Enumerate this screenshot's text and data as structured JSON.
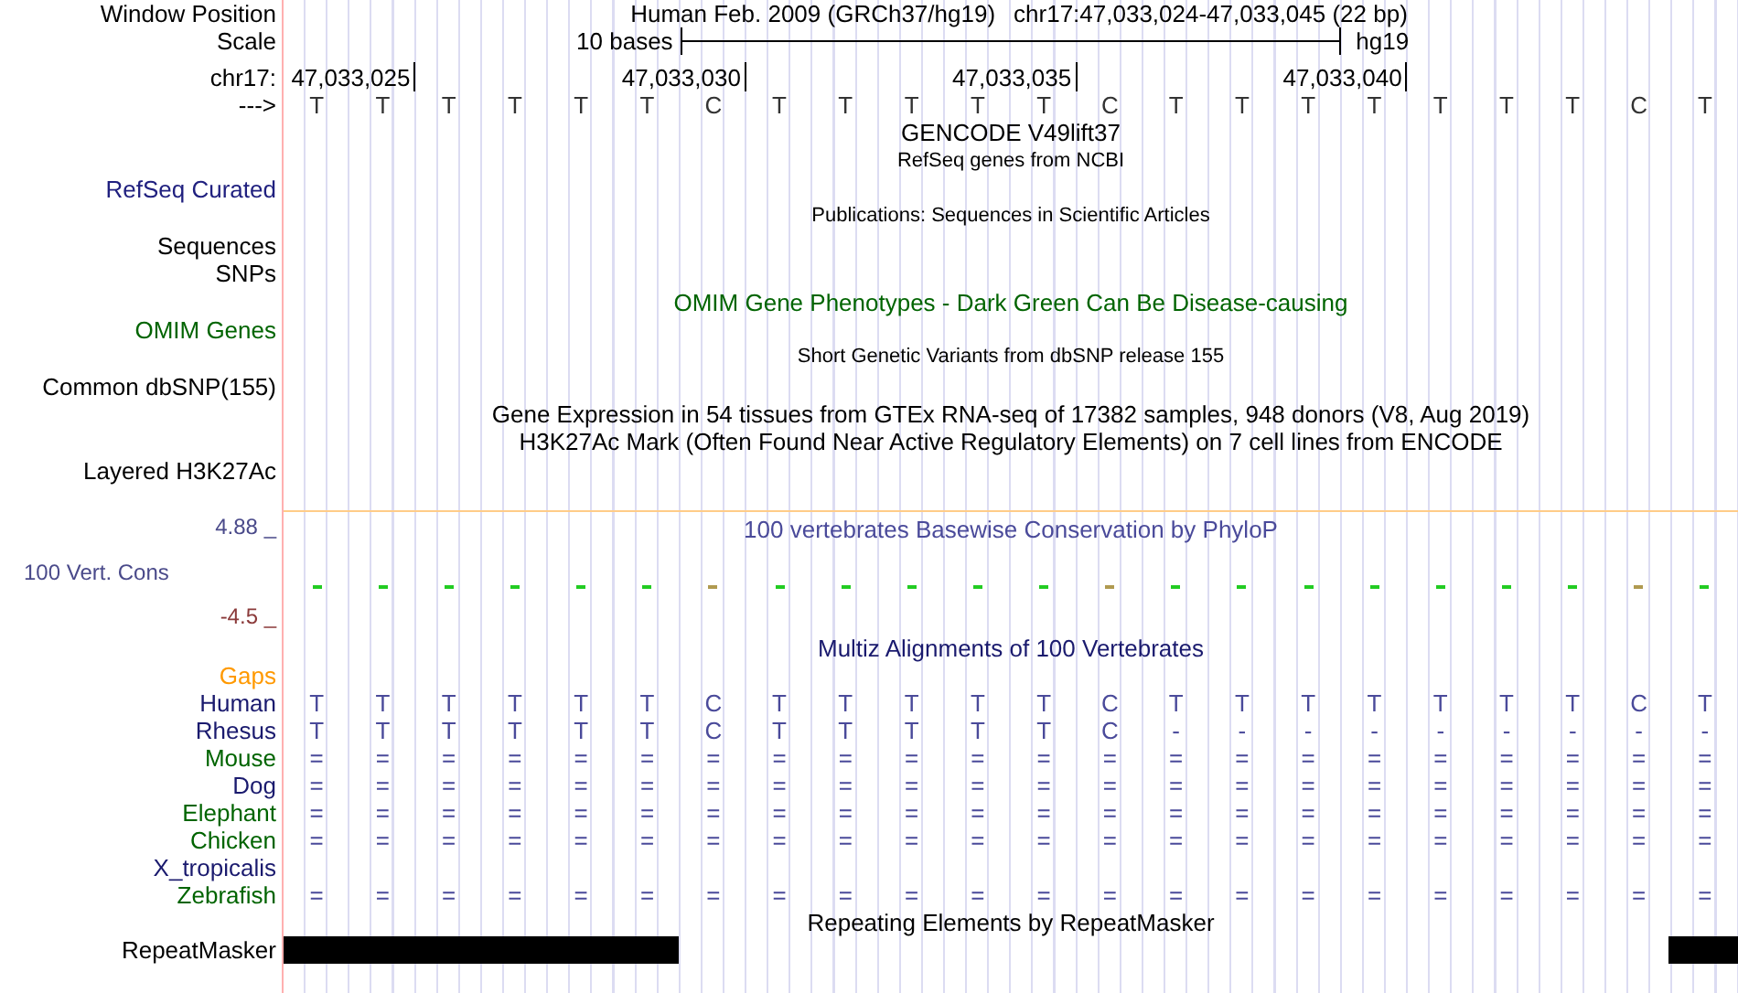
{
  "header": {
    "label": "Window Position",
    "assembly": "Human Feb. 2009 (GRCh37/hg19)",
    "position": "chr17:47,033,024-47,033,045 (22 bp)"
  },
  "scale": {
    "label": "Scale",
    "length": "10 bases",
    "assembly": "hg19"
  },
  "ruler": {
    "label": "chr17:",
    "ticks": [
      "47,033,025",
      "47,033,030",
      "47,033,035",
      "47,033,040"
    ]
  },
  "sequence": {
    "label": "--->",
    "bases": [
      "T",
      "T",
      "T",
      "T",
      "T",
      "T",
      "C",
      "T",
      "T",
      "T",
      "T",
      "T",
      "C",
      "T",
      "T",
      "T",
      "T",
      "T",
      "T",
      "T",
      "C",
      "T"
    ]
  },
  "lines": [
    {
      "kind": "title",
      "text": "GENCODE V49lift37",
      "color": "#000000"
    },
    {
      "kind": "small_title",
      "text": "RefSeq genes from NCBI",
      "color": "#000000"
    },
    {
      "kind": "label",
      "text": "RefSeq Curated",
      "color": "#20207f"
    },
    {
      "kind": "small_title",
      "text": "Publications: Sequences in Scientific Articles",
      "color": "#000000"
    },
    {
      "kind": "label",
      "text": "Sequences",
      "color": "#000000"
    },
    {
      "kind": "label",
      "text": "SNPs",
      "color": "#000000"
    },
    {
      "kind": "title",
      "text": "OMIM Gene Phenotypes - Dark Green Can Be Disease-causing",
      "color": "#006400"
    },
    {
      "kind": "label",
      "text": "OMIM Genes",
      "color": "#006400"
    },
    {
      "kind": "small_title",
      "text": "Short Genetic Variants from dbSNP release 155",
      "color": "#000000"
    },
    {
      "kind": "label",
      "text": "Common dbSNP(155)",
      "color": "#000000"
    },
    {
      "kind": "title",
      "text": "Gene Expression in 54 tissues from GTEx RNA-seq of 17382 samples, 948 donors (V8, Aug 2019)",
      "color": "#000000"
    },
    {
      "kind": "title",
      "text": "H3K27Ac Mark (Often Found Near Active Regulatory Elements) on 7 cell lines from ENCODE",
      "color": "#000000"
    },
    {
      "kind": "label",
      "text": "Layered H3K27Ac",
      "color": "#000000"
    }
  ],
  "conservation": {
    "title": "100 vertebrates Basewise Conservation by PhyloP",
    "label": "100 Vert. Cons",
    "max": "4.88 _",
    "min": "-4.5 _",
    "bars": [
      {
        "color": "#22cc22"
      },
      {
        "color": "#22cc22"
      },
      {
        "color": "#22cc22"
      },
      {
        "color": "#22cc22"
      },
      {
        "color": "#22cc22"
      },
      {
        "color": "#22cc22"
      },
      {
        "color": "#b09a50"
      },
      {
        "color": "#22cc22"
      },
      {
        "color": "#22cc22"
      },
      {
        "color": "#22cc22"
      },
      {
        "color": "#22cc22"
      },
      {
        "color": "#22cc22"
      },
      {
        "color": "#b09a50"
      },
      {
        "color": "#22cc22"
      },
      {
        "color": "#22cc22"
      },
      {
        "color": "#22cc22"
      },
      {
        "color": "#22cc22"
      },
      {
        "color": "#22cc22"
      },
      {
        "color": "#22cc22"
      },
      {
        "color": "#22cc22"
      },
      {
        "color": "#b09a50"
      },
      {
        "color": "#22cc22"
      }
    ]
  },
  "multiz": {
    "title": "Multiz Alignments of 100 Vertebrates",
    "gaps_label": "Gaps",
    "species": [
      {
        "name": "Human",
        "color": "#1a1a6e",
        "bases": [
          "T",
          "T",
          "T",
          "T",
          "T",
          "T",
          "C",
          "T",
          "T",
          "T",
          "T",
          "T",
          "C",
          "T",
          "T",
          "T",
          "T",
          "T",
          "T",
          "T",
          "C",
          "T"
        ]
      },
      {
        "name": "Rhesus",
        "color": "#1a1a6e",
        "bases": [
          "T",
          "T",
          "T",
          "T",
          "T",
          "T",
          "C",
          "T",
          "T",
          "T",
          "T",
          "T",
          "C",
          "-",
          "-",
          "-",
          "-",
          "-",
          "-",
          "-",
          "-",
          "-"
        ]
      },
      {
        "name": "Mouse",
        "color": "#006400",
        "bases": [
          "=",
          "=",
          "=",
          "=",
          "=",
          "=",
          "=",
          "=",
          "=",
          "=",
          "=",
          "=",
          "=",
          "=",
          "=",
          "=",
          "=",
          "=",
          "=",
          "=",
          "=",
          "="
        ]
      },
      {
        "name": "Dog",
        "color": "#1a1a6e",
        "bases": [
          "=",
          "=",
          "=",
          "=",
          "=",
          "=",
          "=",
          "=",
          "=",
          "=",
          "=",
          "=",
          "=",
          "=",
          "=",
          "=",
          "=",
          "=",
          "=",
          "=",
          "=",
          "="
        ]
      },
      {
        "name": "Elephant",
        "color": "#006400",
        "bases": [
          "=",
          "=",
          "=",
          "=",
          "=",
          "=",
          "=",
          "=",
          "=",
          "=",
          "=",
          "=",
          "=",
          "=",
          "=",
          "=",
          "=",
          "=",
          "=",
          "=",
          "=",
          "="
        ]
      },
      {
        "name": "Chicken",
        "color": "#006400",
        "bases": [
          "=",
          "=",
          "=",
          "=",
          "=",
          "=",
          "=",
          "=",
          "=",
          "=",
          "=",
          "=",
          "=",
          "=",
          "=",
          "=",
          "=",
          "=",
          "=",
          "=",
          "=",
          "="
        ]
      },
      {
        "name": "X_tropicalis",
        "color": "#1a1a6e"
      },
      {
        "name": "Zebrafish",
        "color": "#006400",
        "bases": [
          "=",
          "=",
          "=",
          "=",
          "=",
          "=",
          "=",
          "=",
          "=",
          "=",
          "=",
          "=",
          "=",
          "=",
          "=",
          "=",
          "=",
          "=",
          "=",
          "=",
          "=",
          "="
        ]
      }
    ]
  },
  "repeatmasker": {
    "title": "Repeating Elements by RepeatMasker",
    "label": "RepeatMasker"
  }
}
